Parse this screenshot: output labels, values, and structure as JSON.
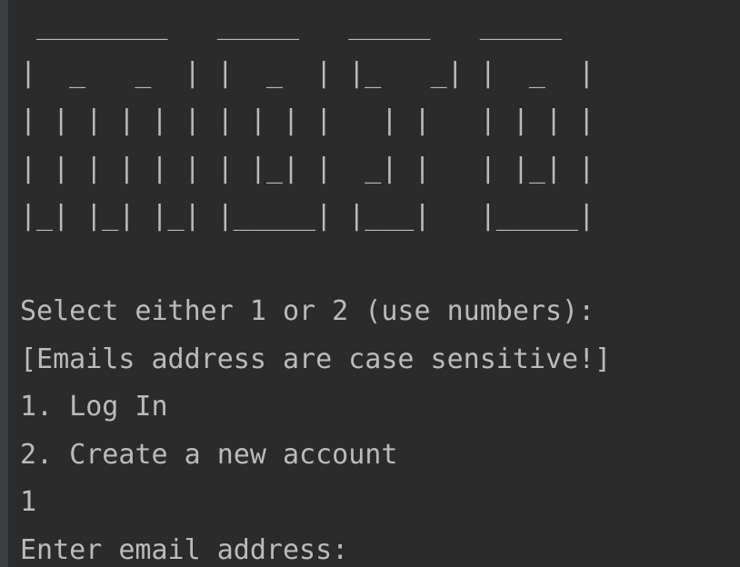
{
  "console": {
    "banner": [
      " ________   _____   _____   _____",
      "|  _   _  | |  _  | |_   _| |  _  |",
      "| | | | | | | | | |   | |   | | | |",
      "| | | | | | | |_| |  _| |   | |_| |",
      "|_| |_| |_| |_____| |___|   |_____|"
    ],
    "blank_line": "",
    "prompt_select": "Select either 1 or 2 (use numbers):",
    "notice": "[Emails address are case sensitive!]",
    "option_1": "1. Log In",
    "option_2": "2. Create a new account",
    "user_input": "1",
    "prompt_email": "Enter email address:"
  }
}
